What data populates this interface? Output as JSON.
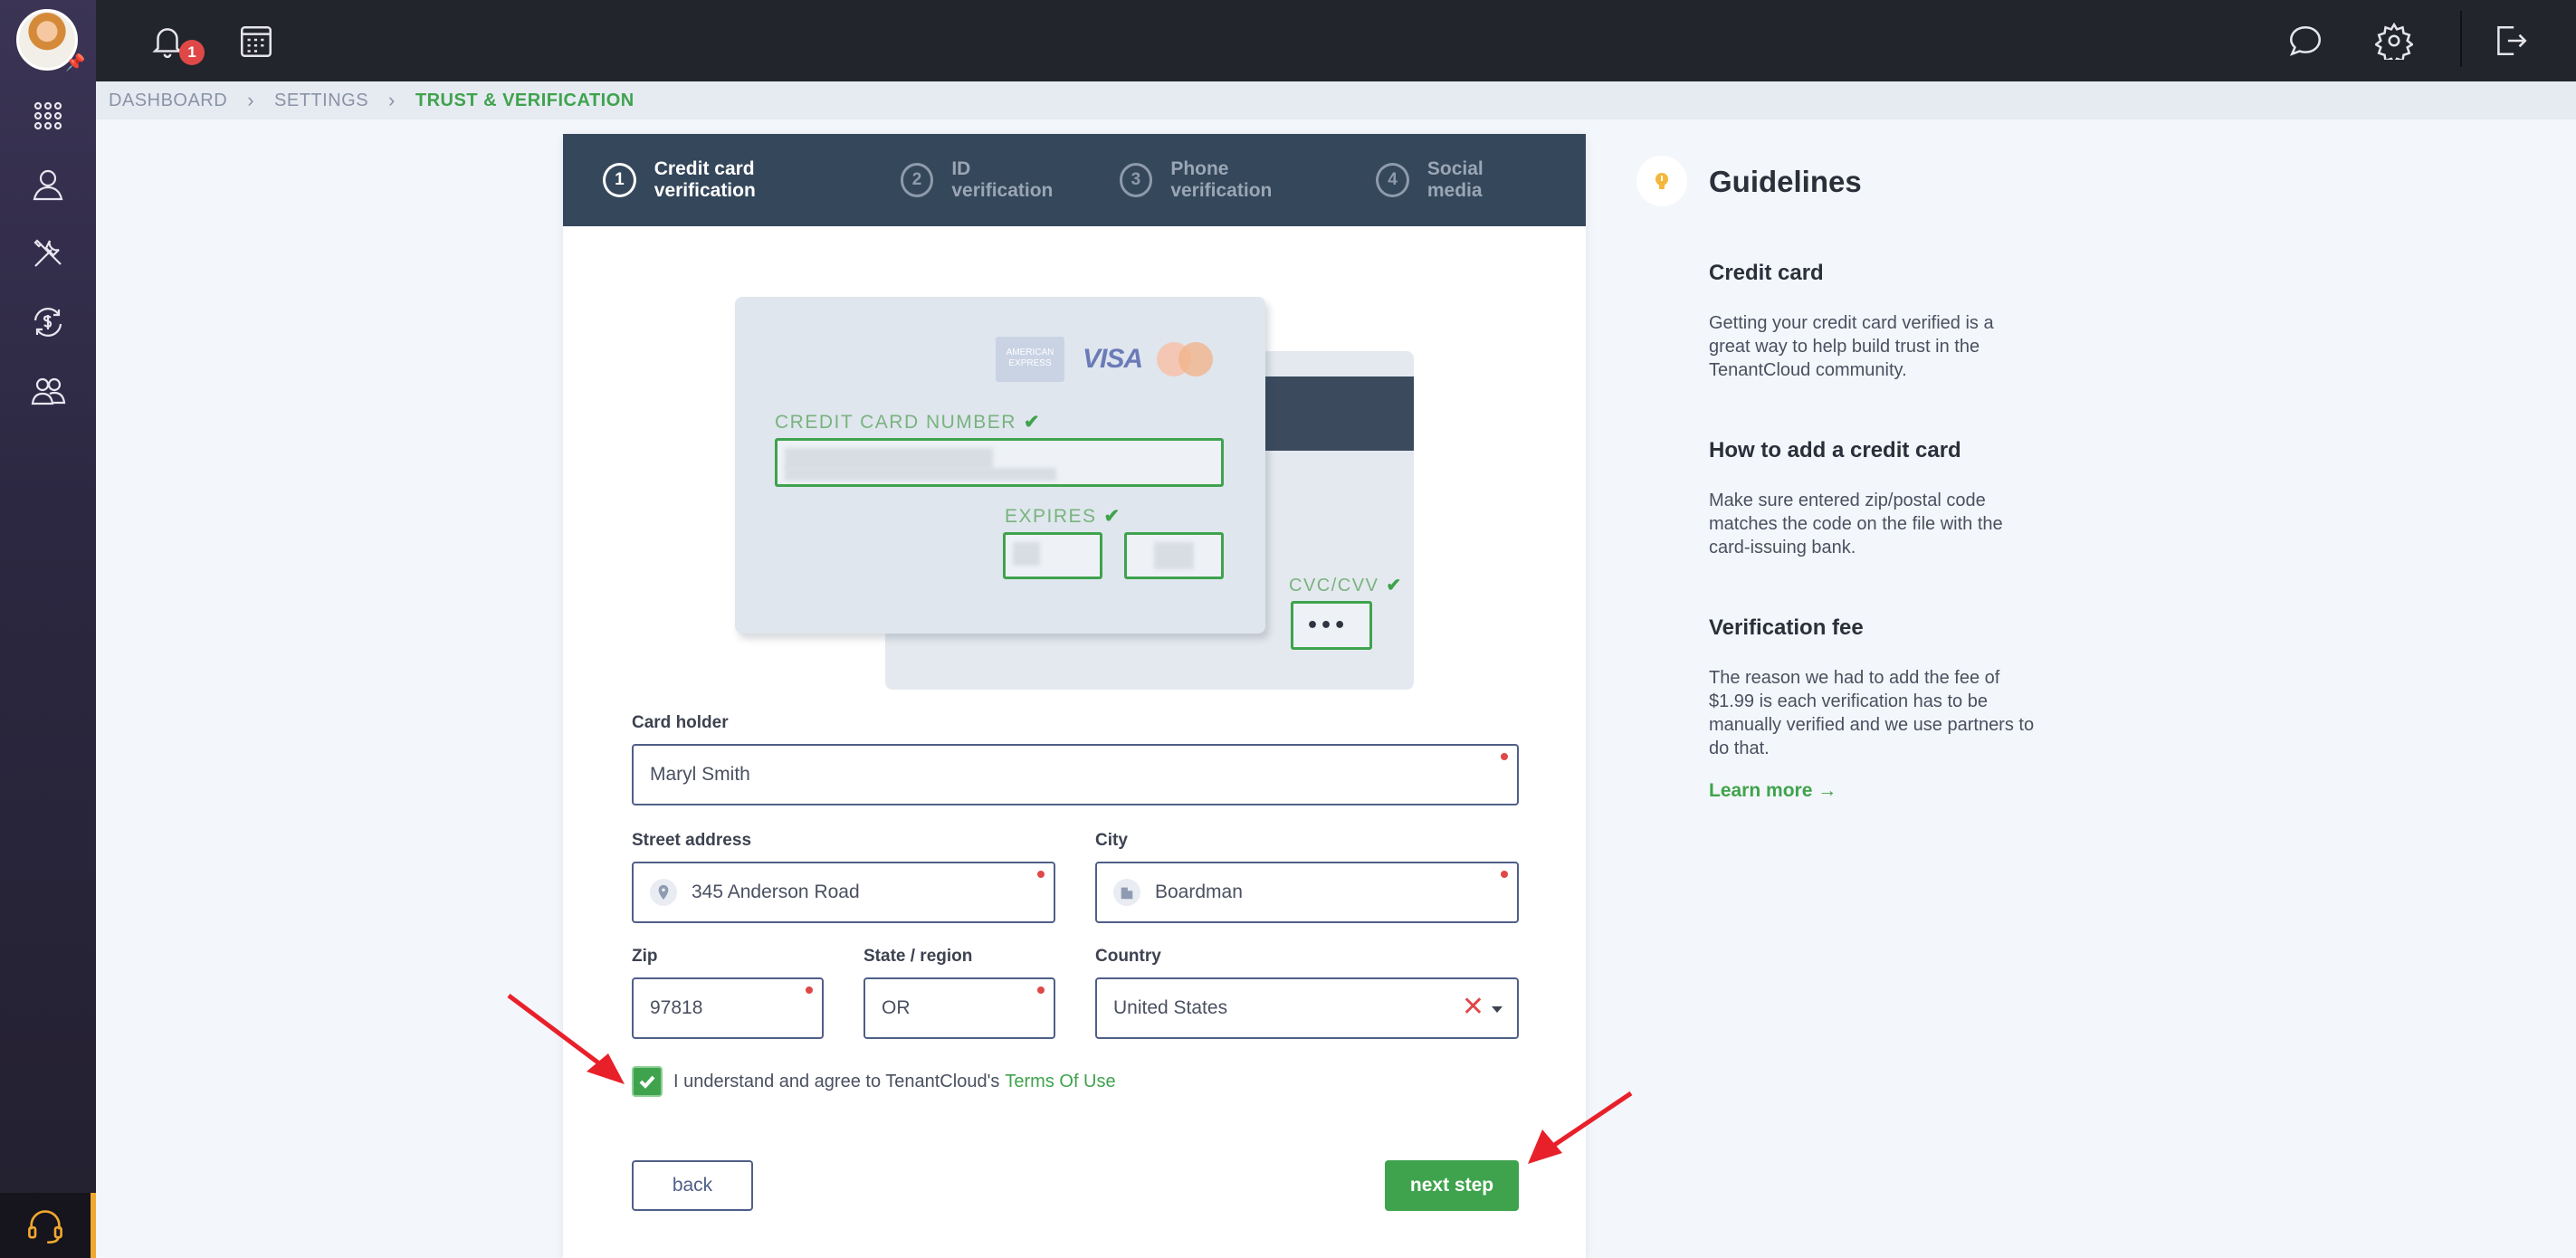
{
  "topbar": {
    "notification_count": "1",
    "icons": [
      "bell-icon",
      "calendar-icon",
      "chat-icon",
      "gear-icon",
      "logout-icon"
    ]
  },
  "sidebar": {
    "items": [
      {
        "name": "apps-grid-icon"
      },
      {
        "name": "user-icon"
      },
      {
        "name": "tools-icon"
      },
      {
        "name": "payments-icon"
      },
      {
        "name": "team-icon"
      }
    ],
    "support_icon": "headset-icon"
  },
  "breadcrumb": [
    "DASHBOARD",
    "SETTINGS",
    "TRUST & VERIFICATION"
  ],
  "steps": [
    {
      "num": "1",
      "label": "Credit card verification",
      "active": true
    },
    {
      "num": "2",
      "label": "ID verification",
      "active": false
    },
    {
      "num": "3",
      "label": "Phone verification",
      "active": false
    },
    {
      "num": "4",
      "label": "Social media",
      "active": false
    }
  ],
  "card_illustration": {
    "amex": "AMERICAN EXPRESS",
    "visa": "VISA",
    "number_label": "CREDIT CARD NUMBER",
    "expires_label": "EXPIRES",
    "cvc_label": "CVC/CVV",
    "cvc_value": "•••",
    "check": "✔"
  },
  "form": {
    "card_holder_label": "Card holder",
    "card_holder_value": "Maryl Smith",
    "street_label": "Street address",
    "street_value": "345 Anderson Road",
    "city_label": "City",
    "city_value": "Boardman",
    "zip_label": "Zip",
    "zip_value": "97818",
    "state_label": "State / region",
    "state_value": "OR",
    "country_label": "Country",
    "country_value": "United States",
    "clear_symbol": "✕",
    "terms_text": "I understand and agree to TenantCloud's",
    "terms_link": "Terms Of Use",
    "terms_checked": true,
    "back_label": "back",
    "next_label": "next step"
  },
  "guidelines": {
    "title": "Guidelines",
    "sections": [
      {
        "heading": "Credit card",
        "body": "Getting your credit card verified is a great way to help build trust in the TenantCloud community."
      },
      {
        "heading": "How to add a credit card",
        "body": "Make sure entered zip/postal code matches the code on the file with the card-issuing bank."
      },
      {
        "heading": "Verification fee",
        "body": "The reason we had to add the fee of $1.99 is each verification has to be manually verified and we use partners to do that."
      }
    ],
    "learn_more": "Learn more →"
  },
  "colors": {
    "accent_green": "#3fa34d",
    "sidebar_bg": "#2c2842",
    "topbar_bg": "#23252d",
    "steps_bg": "#35475a",
    "annotation_red": "#e8202a"
  }
}
